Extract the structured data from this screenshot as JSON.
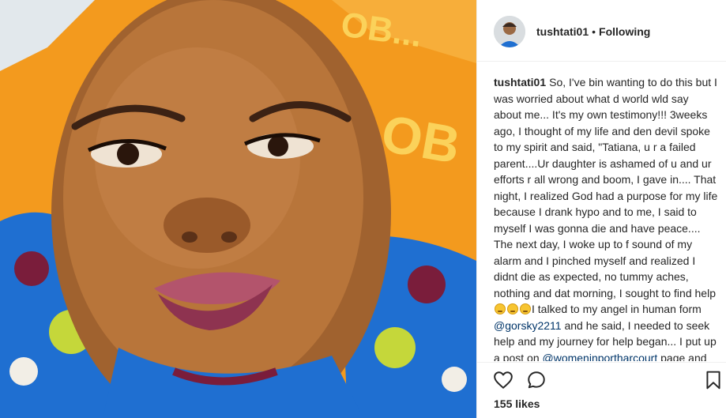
{
  "post": {
    "author": "tushtati01",
    "separator": "•",
    "follow_state": "Following",
    "avatar_icon": "user-avatar",
    "caption": {
      "author": "tushtati01",
      "part1": "So, I've bin wanting to do this but I was worried about what d world wld say about me... It's my own testimony!!! 3weeks ago, I thought of my life and den devil spoke to my spirit and said, \"Tatiana, u r a failed parent....Ur daughter is ashamed of u and ur efforts r all wrong and boom, I gave in.... That night, I realized God had a purpose for my life because I drank hypo and to me, I said to myself I was gonna die and have peace.... The next day, I woke up to f sound of my alarm and I pinched myself and realized I didnt die as expected, no tummy aches, nothing and dat morning, I sought to find help",
      "part2": "I talked to my angel in human form",
      "mention1": "@gorsky2211",
      "part3": "and he said, I needed to seek help and my journey for help began... I put up a post on",
      "mention2": "@womeninportharcourt",
      "part4": "page and then, another angel asked I sent her a DM"
    },
    "likes_text": "155 likes",
    "icons": {
      "like": "heart-icon",
      "comment": "comment-icon",
      "save": "bookmark-icon"
    },
    "colors": {
      "pillow": "#f39a1e",
      "fabric": "#1f6fd1",
      "mention": "#003569"
    }
  }
}
